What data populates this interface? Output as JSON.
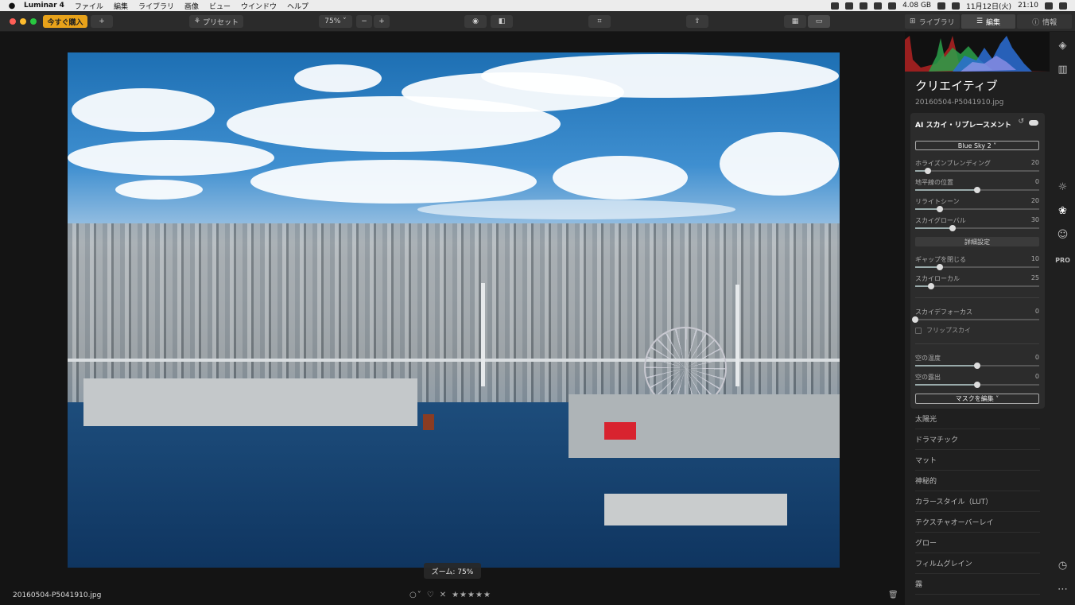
{
  "menubar": {
    "app": "Luminar 4",
    "items": [
      "ファイル",
      "編集",
      "ライブラリ",
      "画像",
      "ビュー",
      "ウインドウ",
      "ヘルプ"
    ],
    "storage": "4.08 GB",
    "date": "11月12日(火)",
    "time": "21:10"
  },
  "toolbar": {
    "buy_label": "今すぐ購入",
    "add_label": "+",
    "presets_label": "プリセット",
    "zoom_value": "75%",
    "zoom_out": "−",
    "zoom_in": "+",
    "tabs": [
      {
        "label": "ライブラリ",
        "icon": "library-icon"
      },
      {
        "label": "編集",
        "icon": "sliders-icon"
      },
      {
        "label": "情報",
        "icon": "info-icon"
      }
    ]
  },
  "canvas": {
    "zoom_tip": "ズーム: 75%",
    "filename": "20160504-P5041910.jpg",
    "stars": "★★★★★"
  },
  "panel": {
    "title": "クリエイティブ",
    "filename": "20160504-P5041910.jpg",
    "module": {
      "title": "AI スカイ・リプレースメント",
      "preset": "Blue Sky 2 ˅",
      "sliders_top": [
        {
          "label": "ホライズンブレンディング",
          "value": "20",
          "pos": 0.1
        },
        {
          "label": "地平線の位置",
          "value": "0",
          "pos": 0.5
        },
        {
          "label": "リライトシーン",
          "value": "20",
          "pos": 0.2
        },
        {
          "label": "スカイグローバル",
          "value": "30",
          "pos": 0.3
        }
      ],
      "advanced_label": "詳細設定",
      "sliders_adv": [
        {
          "label": "ギャップを閉じる",
          "value": "10",
          "pos": 0.2
        },
        {
          "label": "スカイローカル",
          "value": "25",
          "pos": 0.125
        }
      ],
      "defocus": {
        "label": "スカイデフォーカス",
        "value": "0",
        "pos": 0.0
      },
      "flip_label": "フリップスカイ",
      "sliders_bottom": [
        {
          "label": "空の温度",
          "value": "0",
          "pos": 0.5
        },
        {
          "label": "空の露出",
          "value": "0",
          "pos": 0.5
        }
      ],
      "mask_label": "マスクを編集 ˅"
    },
    "tools": [
      "太陽光",
      "ドラマチック",
      "マット",
      "神秘的",
      "カラースタイル（LUT）",
      "テクスチャオーバーレイ",
      "グロー",
      "フィルムグレイン",
      "霧"
    ],
    "rail_pro": "PRO"
  }
}
